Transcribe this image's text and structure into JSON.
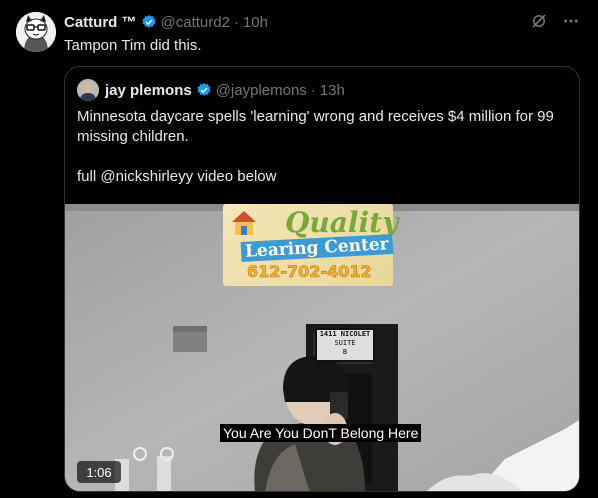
{
  "post": {
    "author_name": "Catturd ™",
    "author_handle": "@catturd2",
    "separator": "·",
    "time": "10h",
    "text": "Tampon Tim did this."
  },
  "quote": {
    "author_name": "jay plemons",
    "author_handle": "@jayplemons",
    "separator": "·",
    "time": "13h",
    "text_line1": "Minnesota daycare spells 'learning' wrong and receives $4 million for 99 missing children.",
    "text_line2": "full @nickshirleyy video below"
  },
  "video": {
    "sign_line1": "Quality",
    "sign_line2": "Learing Center",
    "sign_phone": "612-702-4012",
    "door_line1": "1411 NICOLET",
    "door_line2": "SUITE",
    "door_line3": "B",
    "caption": "You Are You DonT Belong Here",
    "duration": "1:06"
  },
  "icons": {
    "grok": "grok-slash-icon",
    "more": "more-dots-icon",
    "verified": "verified-badge-icon"
  },
  "colors": {
    "background": "#000000",
    "text_primary": "#e7e9ea",
    "text_muted": "#71767b",
    "verified_blue": "#1d9bf0",
    "border": "#2f3336"
  }
}
